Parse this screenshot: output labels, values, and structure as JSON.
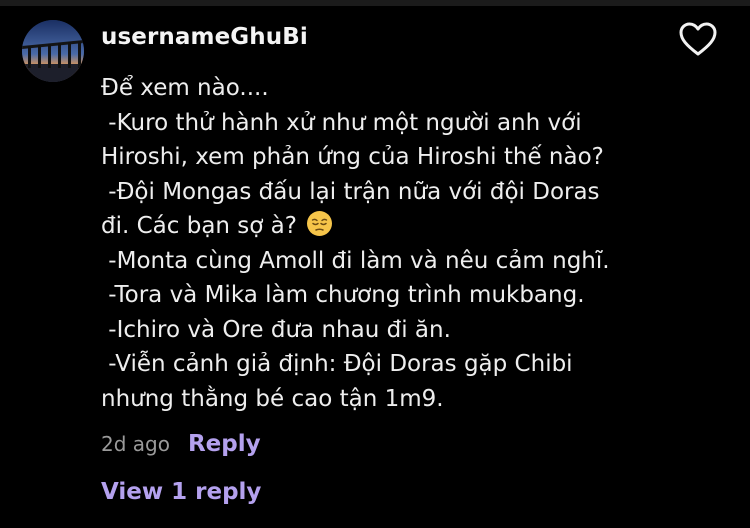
{
  "comment": {
    "username": "usernameGhuBi",
    "body_lines": [
      "Để xem nào....",
      " -Kuro thử hành xử như một người anh với",
      "Hiroshi, xem phản ứng của Hiroshi thế nào?",
      " -Đội Mongas đấu lại trận nữa với đội Doras",
      "đi. Các bạn sợ à?",
      " -Monta cùng Amoll đi làm và nêu cảm nghĩ.",
      " -Tora và Mika làm chương trình mukbang.",
      " -Ichiro và Ore đưa nhau đi ăn.",
      " -Viễn cảnh giả định: Đội Doras gặp Chibi",
      "nhưng thằng bé cao tận 1m9."
    ],
    "emoji": "pensive-face-emoji",
    "time": "2d ago",
    "reply_label": "Reply",
    "view_replies_label": "View 1 reply"
  },
  "icons": {
    "like": "heart-outline-icon",
    "avatar": "bridge-sunset-avatar"
  },
  "colors": {
    "background": "#000000",
    "text": "#eeeeee",
    "muted": "#9a9a9a",
    "accent": "#b4a1ee"
  }
}
